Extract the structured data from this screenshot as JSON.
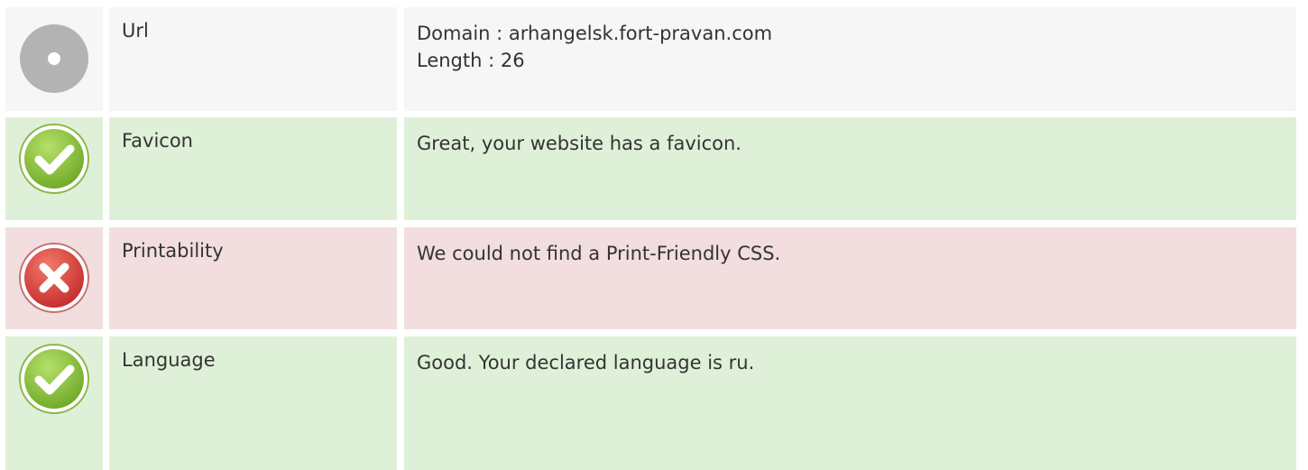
{
  "rows": [
    {
      "status": "neutral",
      "icon": "neutral-circle-icon",
      "label": "Url",
      "lines": [
        "Domain : arhangelsk.fort-pravan.com",
        "Length : 26"
      ]
    },
    {
      "status": "pass",
      "icon": "check-icon",
      "label": "Favicon",
      "lines": [
        "Great, your website has a favicon."
      ]
    },
    {
      "status": "fail",
      "icon": "cross-icon",
      "label": "Printability",
      "lines": [
        "We could not find a Print-Friendly CSS."
      ]
    },
    {
      "status": "pass",
      "icon": "check-icon",
      "label": "Language",
      "lines": [
        "Good. Your declared language is ru."
      ]
    }
  ],
  "colors": {
    "neutral_bg": "#f6f6f6",
    "pass_bg": "#dff0d8",
    "fail_bg": "#f2dede",
    "pass_icon": "#8cc43a",
    "fail_icon": "#d9393a",
    "neutral_icon": "#b3b3b3"
  }
}
